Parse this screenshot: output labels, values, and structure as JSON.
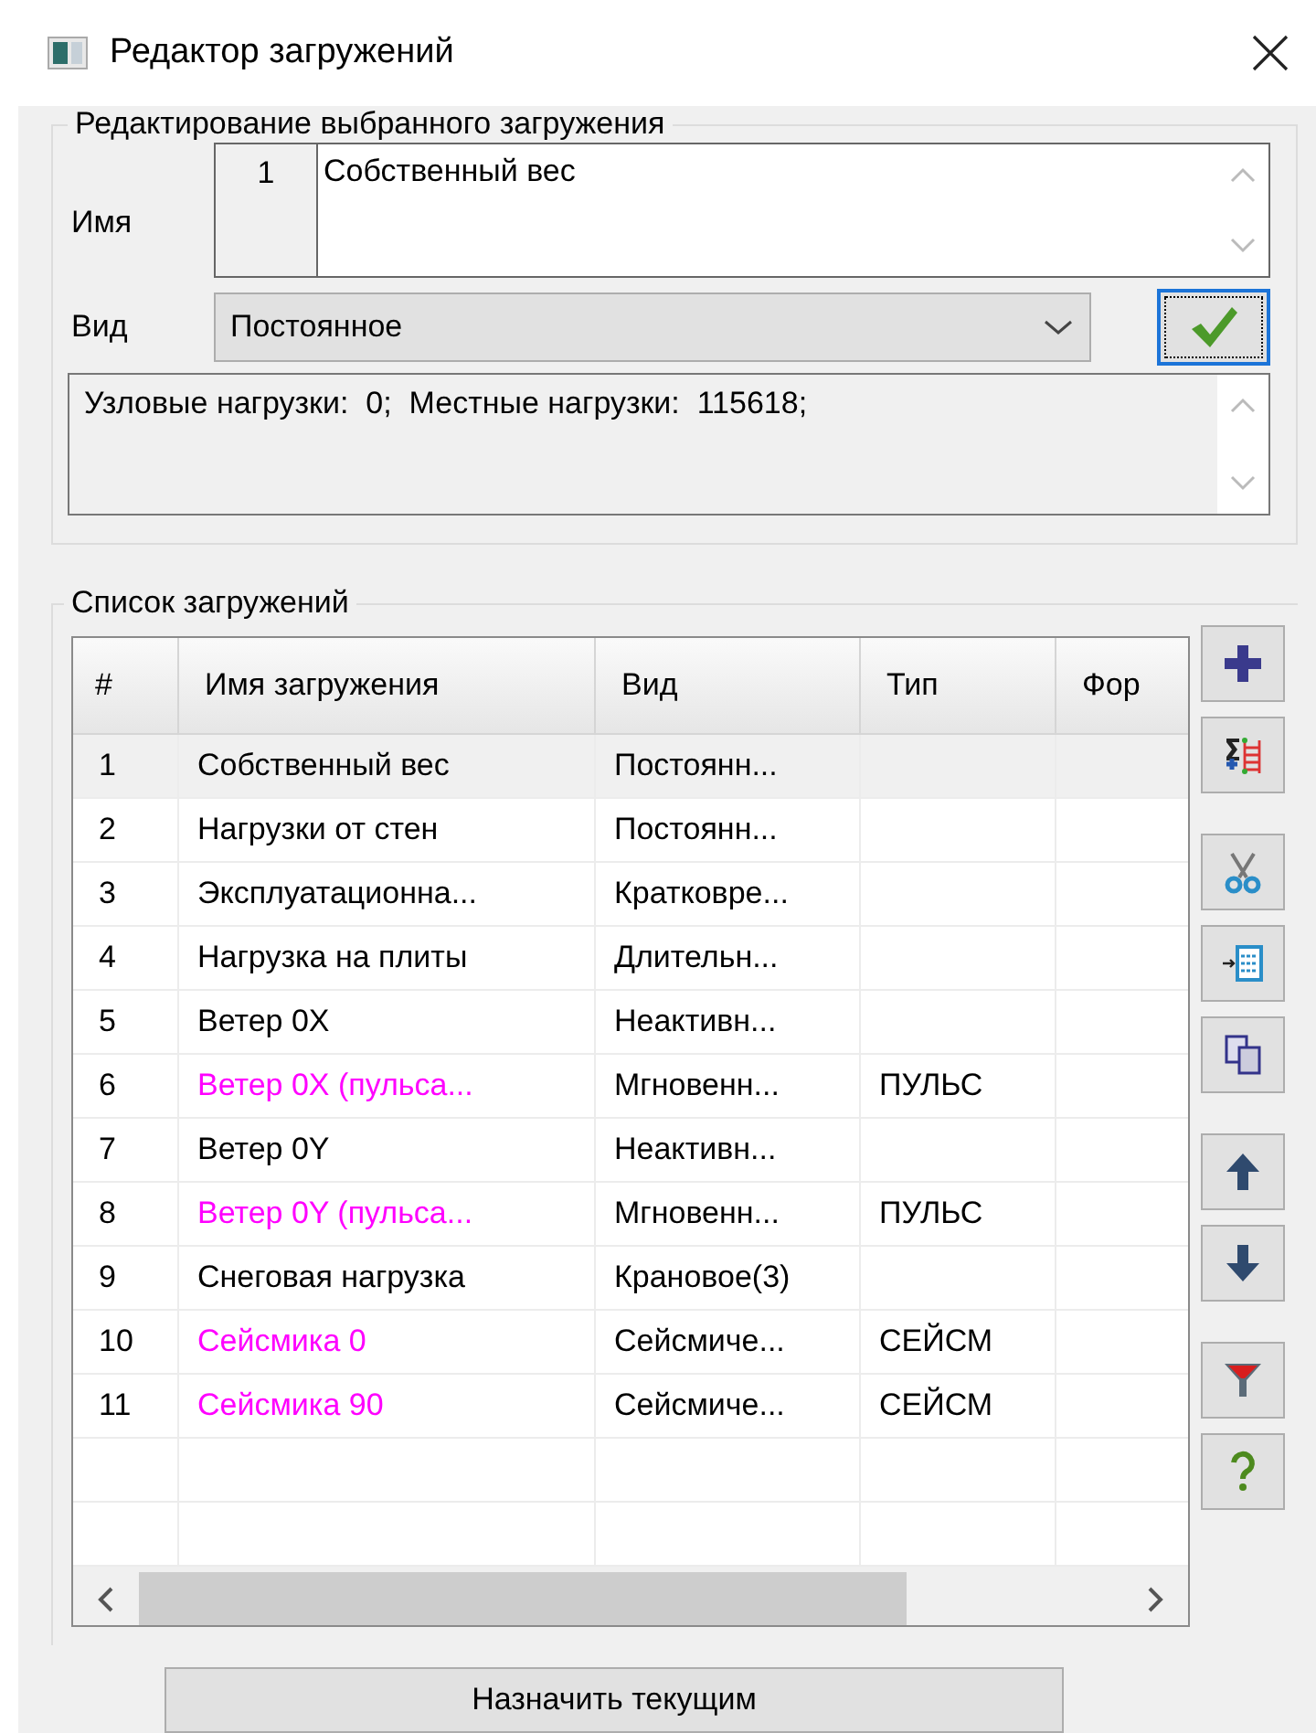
{
  "window": {
    "title": "Редактор загружений"
  },
  "edit_group": {
    "title": "Редактирование выбранного загружения",
    "name_label": "Имя",
    "number": "1",
    "name": "Собственный вес",
    "kind_label": "Вид",
    "kind": "Постоянное",
    "info": "Узловые нагрузки:  0;  Местные нагрузки:  115618;"
  },
  "list_group": {
    "title": "Список загружений",
    "columns": [
      "#",
      "Имя загружения",
      "Вид",
      "Тип",
      "Фор"
    ],
    "rows": [
      {
        "number": "1",
        "name": "Собственный вес",
        "kind": "Постоянн...",
        "color": "#000000",
        "selected": true
      },
      {
        "number": "2",
        "name": "Нагрузки от стен",
        "kind": "Постоянн...",
        "color": "#000000",
        "selected": false
      },
      {
        "number": "3",
        "name": "Эксплуатационна...",
        "kind": "Кратковре...",
        "color": "#000000",
        "selected": false
      },
      {
        "number": "4",
        "name": "Нагрузка на плиты",
        "kind": "Длительн...",
        "color": "#000000",
        "selected": false
      },
      {
        "number": "5",
        "name": "Ветер 0X",
        "kind": "Неактивн...",
        "color": "#000000",
        "selected": false
      },
      {
        "number": "6",
        "name": "Ветер 0X (пульса...",
        "kind": "Мгновенн...",
        "type": "ПУЛЬС",
        "color": "#ff00ff",
        "selected": false
      },
      {
        "number": "7",
        "name": "Ветер 0Y",
        "kind": "Неактивн...",
        "color": "#000000",
        "selected": false
      },
      {
        "number": "8",
        "name": "Ветер 0Y (пульса...",
        "kind": "Мгновенн...",
        "type": "ПУЛЬС",
        "color": "#ff00ff",
        "selected": false
      },
      {
        "number": "9",
        "name": "Снеговая нагрузка",
        "kind": "Крановое(3)",
        "color": "#000000",
        "selected": false
      },
      {
        "number": "10",
        "name": "Сейсмика 0",
        "kind": "Сейсмиче...",
        "type": "СЕЙСМ",
        "color": "#ff00ff",
        "selected": false
      },
      {
        "number": "11",
        "name": "Сейсмика 90",
        "kind": "Сейсмиче...",
        "type": "СЕЙСМ",
        "color": "#ff00ff",
        "selected": false
      }
    ]
  },
  "assign_button": "Назначить текущим"
}
